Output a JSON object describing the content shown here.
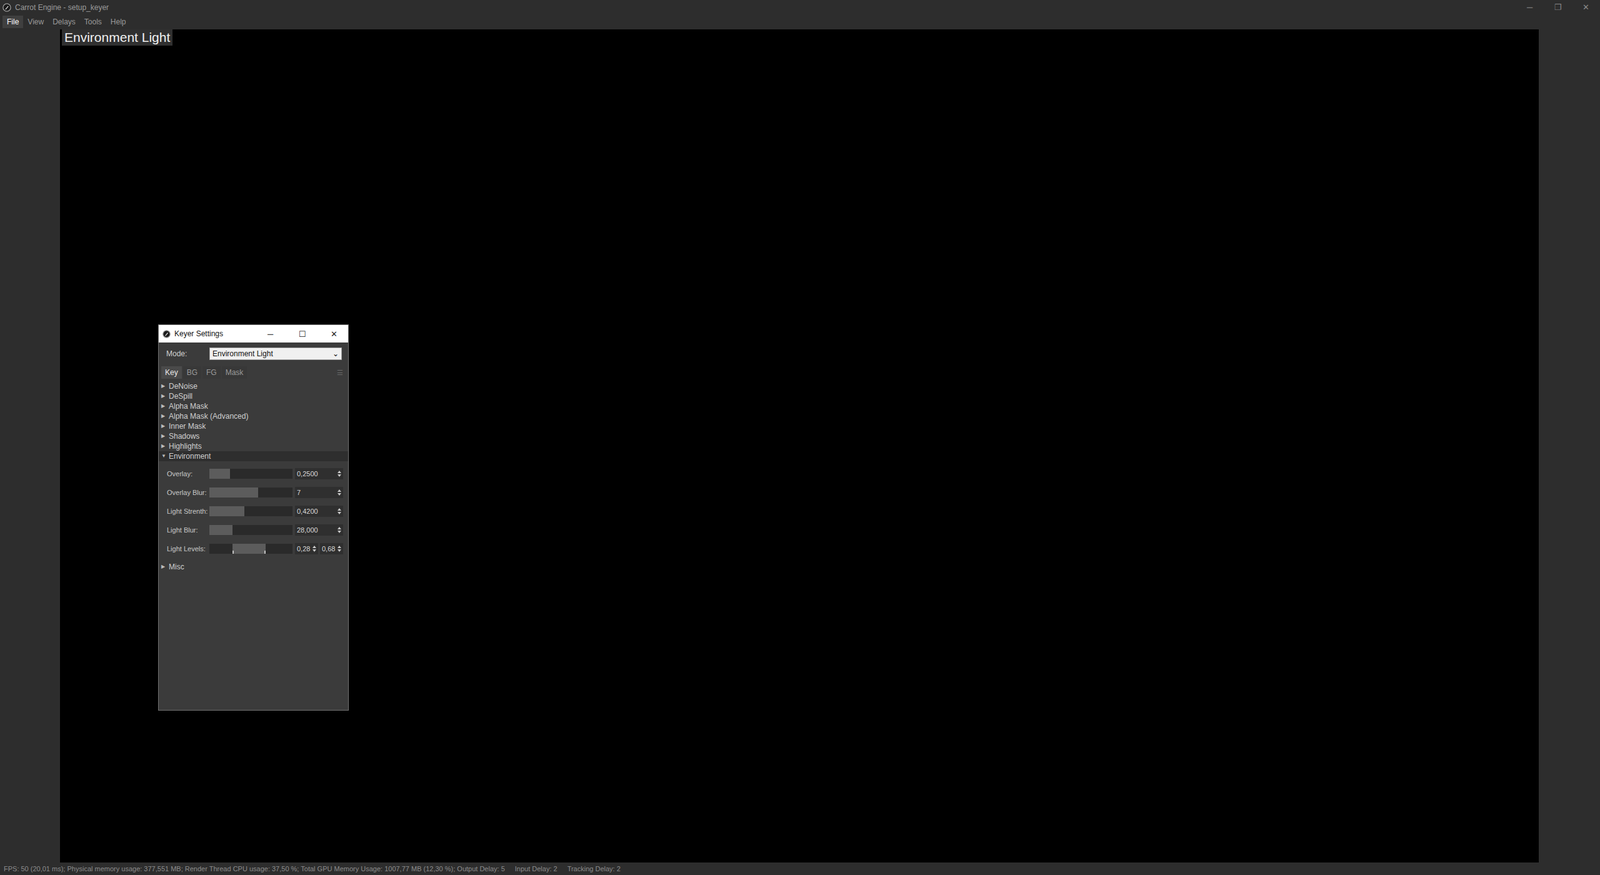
{
  "window": {
    "title": "Carrot Engine - setup_keyer",
    "controls": [
      "─",
      "❐",
      "✕"
    ]
  },
  "menu": [
    {
      "label": "File",
      "selected": true
    },
    {
      "label": "View",
      "selected": false
    },
    {
      "label": "Delays",
      "selected": false
    },
    {
      "label": "Tools",
      "selected": false
    },
    {
      "label": "Help",
      "selected": false
    }
  ],
  "viewport": {
    "label": "Environment Light"
  },
  "keyer": {
    "title": "Keyer Settings",
    "controls": [
      "─",
      "☐",
      "✕"
    ],
    "mode": {
      "label": "Mode:",
      "value": "Environment Light",
      "arrow": "⌄"
    },
    "tabs": [
      {
        "label": "Key",
        "selected": true
      },
      {
        "label": "BG",
        "selected": false
      },
      {
        "label": "FG",
        "selected": false
      },
      {
        "label": "Mask",
        "selected": false
      }
    ],
    "tabs_menu": "☰",
    "sections": [
      {
        "label": "DeNoise",
        "expanded": false,
        "arrow": "▶",
        "params": []
      },
      {
        "label": "DeSpill",
        "expanded": false,
        "arrow": "▶",
        "params": []
      },
      {
        "label": "Alpha Mask",
        "expanded": false,
        "arrow": "▶",
        "params": []
      },
      {
        "label": "Alpha Mask (Advanced)",
        "expanded": false,
        "arrow": "▶",
        "params": []
      },
      {
        "label": "Inner Mask",
        "expanded": false,
        "arrow": "▶",
        "params": []
      },
      {
        "label": "Shadows",
        "expanded": false,
        "arrow": "▶",
        "params": []
      },
      {
        "label": "Highlights",
        "expanded": false,
        "arrow": "▶",
        "params": []
      },
      {
        "label": "Environment",
        "expanded": true,
        "arrow": "▼",
        "params": [
          {
            "label": "Overlay:",
            "kind": "slider",
            "level": 0.25,
            "values": [
              "0,2500"
            ]
          },
          {
            "label": "Overlay Blur:",
            "kind": "slider",
            "level": 0.59,
            "values": [
              "7"
            ]
          },
          {
            "label": "Light Strenth:",
            "kind": "slider",
            "level": 0.42,
            "values": [
              "0,4200"
            ]
          },
          {
            "label": "Light Blur:",
            "kind": "slider",
            "level": 0.28,
            "values": [
              "28,000"
            ]
          },
          {
            "label": "Light Levels:",
            "kind": "range",
            "low": 0.28,
            "high": 0.68,
            "values": [
              "0,28",
              "0,68"
            ]
          }
        ]
      },
      {
        "label": "Misc",
        "expanded": false,
        "arrow": "▶",
        "params": []
      }
    ]
  },
  "status_bar": {
    "items": [
      "FPS: 50 (20,01 ms); Physical memory usage: 377,551 MB; Render Thread CPU usage: 37,50 %; Total GPU Memory Usage: 1007,77 MB (12,30 %); Output Delay: 5",
      "Input Delay: 2",
      "Tracking Delay: 2"
    ]
  }
}
